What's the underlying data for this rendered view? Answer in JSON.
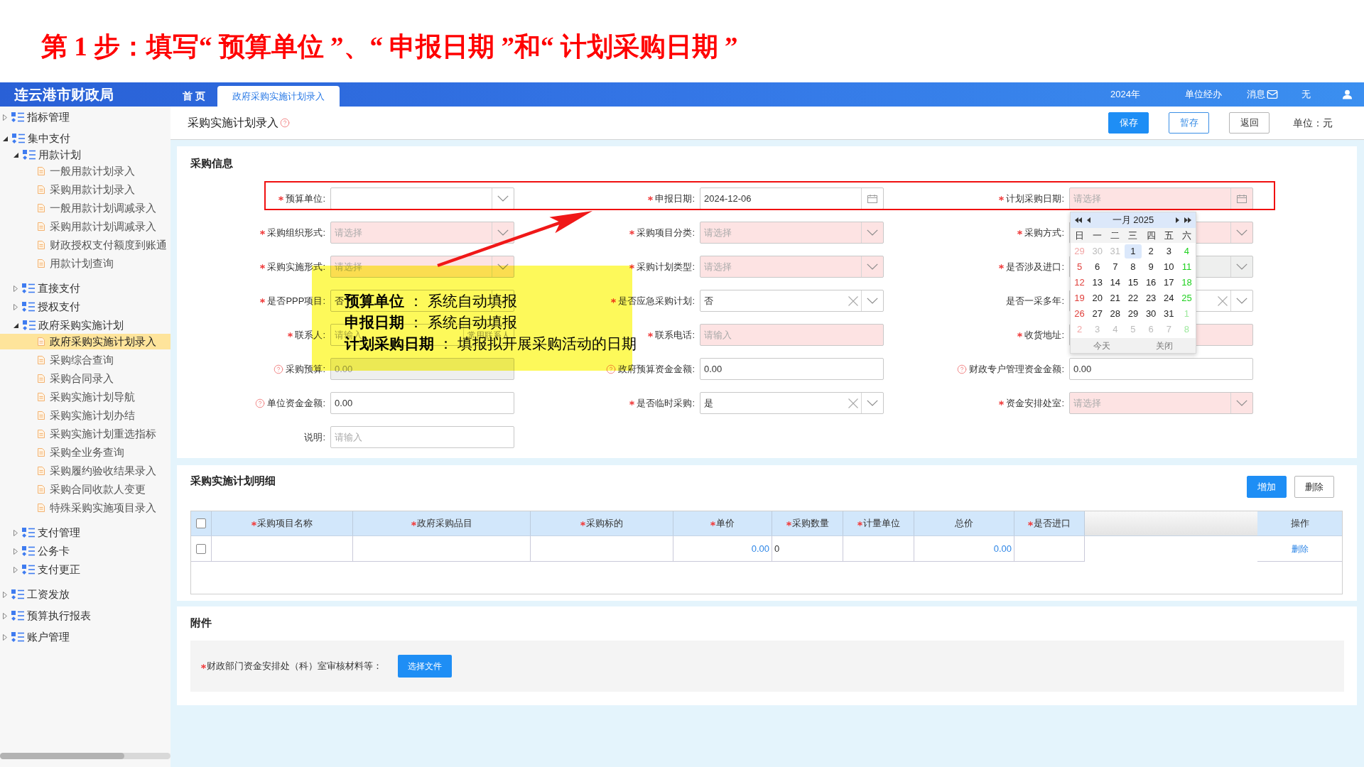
{
  "instruction": {
    "text": "第 1 步：填写“ 预算单位 ”、“ 申报日期 ”和“ 计划采购日期 ”"
  },
  "header": {
    "logo": "连云港市财政局",
    "tabs": [
      {
        "label": "首 页",
        "selected": false
      },
      {
        "label": "政府采购实施计划录入",
        "selected": true
      }
    ],
    "year": "2024年",
    "role": "单位经办",
    "messages": "消息",
    "user_name": "无"
  },
  "sidebar": {
    "items": [
      {
        "label": "指标管理",
        "kind": "folder",
        "expanded": false,
        "selected": false
      },
      {
        "label": "集中支付",
        "kind": "folder",
        "expanded": true,
        "selected": false,
        "children": [
          {
            "label": "用款计划",
            "kind": "folder",
            "expanded": true,
            "selected": false,
            "children": [
              {
                "label": "一般用款计划录入",
                "kind": "page",
                "selected": false
              },
              {
                "label": "采购用款计划录入",
                "kind": "page",
                "selected": false
              },
              {
                "label": "一般用款计划调减录入",
                "kind": "page",
                "selected": false
              },
              {
                "label": "采购用款计划调减录入",
                "kind": "page",
                "selected": false
              },
              {
                "label": "财政授权支付额度到账通",
                "kind": "page",
                "selected": false
              },
              {
                "label": "用款计划查询",
                "kind": "page",
                "selected": false
              }
            ]
          },
          {
            "label": "直接支付",
            "kind": "folder",
            "expanded": false,
            "selected": false
          },
          {
            "label": "授权支付",
            "kind": "folder",
            "expanded": false,
            "selected": false
          },
          {
            "label": "政府采购实施计划",
            "kind": "folder",
            "expanded": true,
            "selected": false,
            "children": [
              {
                "label": "政府采购实施计划录入",
                "kind": "page",
                "selected": true
              },
              {
                "label": "采购综合查询",
                "kind": "page",
                "selected": false
              },
              {
                "label": "采购合同录入",
                "kind": "page",
                "selected": false
              },
              {
                "label": "采购实施计划导航",
                "kind": "page",
                "selected": false
              },
              {
                "label": "采购实施计划办结",
                "kind": "page",
                "selected": false
              },
              {
                "label": "采购实施计划重选指标",
                "kind": "page",
                "selected": false
              },
              {
                "label": "采购全业务查询",
                "kind": "page",
                "selected": false
              },
              {
                "label": "采购履约验收结果录入",
                "kind": "page",
                "selected": false
              },
              {
                "label": "采购合同收款人变更",
                "kind": "page",
                "selected": false
              },
              {
                "label": "特殊采购实施项目录入",
                "kind": "page",
                "selected": false
              }
            ]
          },
          {
            "label": "支付管理",
            "kind": "folder",
            "expanded": false,
            "selected": false
          },
          {
            "label": "公务卡",
            "kind": "folder",
            "expanded": false,
            "selected": false
          },
          {
            "label": "支付更正",
            "kind": "folder",
            "expanded": false,
            "selected": false
          }
        ]
      },
      {
        "label": "工资发放",
        "kind": "folder",
        "expanded": false,
        "selected": false
      },
      {
        "label": "预算执行报表",
        "kind": "folder",
        "expanded": false,
        "selected": false
      },
      {
        "label": "账户管理",
        "kind": "folder",
        "expanded": false,
        "selected": false
      }
    ]
  },
  "page": {
    "title": "采购实施计划录入",
    "buttons": [
      {
        "label": "保存",
        "kind": "primary"
      },
      {
        "label": "暂存",
        "kind": "outline"
      },
      {
        "label": "返回",
        "kind": "plain"
      }
    ],
    "unit": "单位：元"
  },
  "purchase_info": {
    "title": "采购信息",
    "fields": [
      {
        "label": "预算单位:",
        "kind": "select",
        "required": true,
        "help": false,
        "invalid": false,
        "disabled": false,
        "clearable": false
      },
      {
        "label": "申报日期:",
        "kind": "date",
        "value": "2024-12-06",
        "required": true,
        "help": false,
        "invalid": false,
        "disabled": false,
        "clearable": false
      },
      {
        "label": "计划采购日期:",
        "kind": "date",
        "placeholder": "请选择",
        "required": true,
        "help": false,
        "invalid": true,
        "disabled": false,
        "clearable": false
      },
      {
        "label": "采购组织形式:",
        "kind": "select",
        "placeholder": "请选择",
        "required": true,
        "help": false,
        "invalid": true,
        "disabled": false,
        "clearable": false
      },
      {
        "label": "采购项目分类:",
        "kind": "select",
        "placeholder": "请选择",
        "required": true,
        "help": false,
        "invalid": true,
        "disabled": false,
        "clearable": false
      },
      {
        "label": "采购方式:",
        "kind": "select",
        "required": true,
        "help": false,
        "invalid": true,
        "disabled": false,
        "clearable": false
      },
      {
        "label": "采购实施形式:",
        "kind": "select",
        "placeholder": "请选择",
        "required": true,
        "help": false,
        "invalid": true,
        "disabled": false,
        "clearable": false
      },
      {
        "label": "采购计划类型:",
        "kind": "select",
        "placeholder": "请选择",
        "required": true,
        "help": false,
        "invalid": true,
        "disabled": false,
        "clearable": false
      },
      {
        "label": "是否涉及进口:",
        "kind": "select",
        "required": true,
        "help": false,
        "invalid": false,
        "disabled": true,
        "clearable": false
      },
      {
        "label": "是否PPP项目:",
        "kind": "select",
        "value": "否",
        "required": true,
        "help": false,
        "invalid": false,
        "disabled": false,
        "clearable": false
      },
      {
        "label": "是否应急采购计划:",
        "kind": "select",
        "value": "否",
        "required": true,
        "help": false,
        "invalid": false,
        "disabled": false,
        "clearable": true
      },
      {
        "label": "是否一采多年:",
        "kind": "select",
        "required": false,
        "help": false,
        "invalid": false,
        "disabled": false,
        "clearable": true
      },
      {
        "label": "联系人:",
        "kind": "text",
        "placeholder": "请输入",
        "action": "常用联系人",
        "required": true,
        "help": false,
        "invalid": false,
        "disabled": false,
        "clearable": false
      },
      {
        "label": "联系电话:",
        "kind": "text",
        "placeholder": "请输入",
        "required": true,
        "help": false,
        "invalid": true,
        "disabled": false,
        "clearable": false
      },
      {
        "label": "收货地址:",
        "kind": "text",
        "required": true,
        "help": false,
        "invalid": true,
        "disabled": false,
        "clearable": false
      },
      {
        "label": "采购预算:",
        "kind": "text",
        "value": "0.00",
        "required": false,
        "help": true,
        "invalid": false,
        "disabled": true,
        "clearable": false
      },
      {
        "label": "政府预算资金金额:",
        "kind": "text",
        "value": "0.00",
        "required": false,
        "help": true,
        "invalid": false,
        "disabled": false,
        "clearable": false
      },
      {
        "label": "财政专户管理资金金额:",
        "kind": "text",
        "value": "0.00",
        "required": false,
        "help": true,
        "invalid": false,
        "disabled": false,
        "clearable": false
      },
      {
        "label": "单位资金金额:",
        "kind": "text",
        "value": "0.00",
        "required": false,
        "help": true,
        "invalid": false,
        "disabled": false,
        "clearable": false
      },
      {
        "label": "是否临时采购:",
        "kind": "select",
        "value": "是",
        "required": true,
        "help": false,
        "invalid": false,
        "disabled": false,
        "clearable": true
      },
      {
        "label": "资金安排处室:",
        "kind": "select",
        "placeholder": "请选择",
        "required": true,
        "help": false,
        "invalid": true,
        "disabled": false,
        "clearable": false
      },
      {
        "label": "说明:",
        "kind": "text",
        "placeholder": "请输入",
        "required": false,
        "help": false,
        "invalid": false,
        "disabled": false,
        "clearable": false
      }
    ],
    "calendar": {
      "title": "一月 2025",
      "weekdays": [
        "日",
        "一",
        "二",
        "三",
        "四",
        "五",
        "六"
      ],
      "days": [
        {
          "text": "29",
          "outside": true,
          "selected": false
        },
        {
          "text": "30",
          "outside": true,
          "selected": false
        },
        {
          "text": "31",
          "outside": true,
          "selected": false
        },
        {
          "text": "1",
          "outside": false,
          "selected": true
        },
        {
          "text": "2",
          "outside": false,
          "selected": false
        },
        {
          "text": "3",
          "outside": false,
          "selected": false
        },
        {
          "text": "4",
          "outside": false,
          "selected": false
        },
        {
          "text": "5",
          "outside": false,
          "selected": false
        },
        {
          "text": "6",
          "outside": false,
          "selected": false
        },
        {
          "text": "7",
          "outside": false,
          "selected": false
        },
        {
          "text": "8",
          "outside": false,
          "selected": false
        },
        {
          "text": "9",
          "outside": false,
          "selected": false
        },
        {
          "text": "10",
          "outside": false,
          "selected": false
        },
        {
          "text": "11",
          "outside": false,
          "selected": false
        },
        {
          "text": "12",
          "outside": false,
          "selected": false
        },
        {
          "text": "13",
          "outside": false,
          "selected": false
        },
        {
          "text": "14",
          "outside": false,
          "selected": false
        },
        {
          "text": "15",
          "outside": false,
          "selected": false
        },
        {
          "text": "16",
          "outside": false,
          "selected": false
        },
        {
          "text": "17",
          "outside": false,
          "selected": false
        },
        {
          "text": "18",
          "outside": false,
          "selected": false
        },
        {
          "text": "19",
          "outside": false,
          "selected": false
        },
        {
          "text": "20",
          "outside": false,
          "selected": false
        },
        {
          "text": "21",
          "outside": false,
          "selected": false
        },
        {
          "text": "22",
          "outside": false,
          "selected": false
        },
        {
          "text": "23",
          "outside": false,
          "selected": false
        },
        {
          "text": "24",
          "outside": false,
          "selected": false
        },
        {
          "text": "25",
          "outside": false,
          "selected": false
        },
        {
          "text": "26",
          "outside": false,
          "selected": false
        },
        {
          "text": "27",
          "outside": false,
          "selected": false
        },
        {
          "text": "28",
          "outside": false,
          "selected": false
        },
        {
          "text": "29",
          "outside": false,
          "selected": false
        },
        {
          "text": "30",
          "outside": false,
          "selected": false
        },
        {
          "text": "31",
          "outside": false,
          "selected": false
        },
        {
          "text": "1",
          "outside": true,
          "selected": false
        },
        {
          "text": "2",
          "outside": true,
          "selected": false
        },
        {
          "text": "3",
          "outside": true,
          "selected": false
        },
        {
          "text": "4",
          "outside": true,
          "selected": false
        },
        {
          "text": "5",
          "outside": true,
          "selected": false
        },
        {
          "text": "6",
          "outside": true,
          "selected": false
        },
        {
          "text": "7",
          "outside": true,
          "selected": false
        },
        {
          "text": "8",
          "outside": true,
          "selected": false
        }
      ],
      "footer": [
        "今天",
        "关闭"
      ]
    }
  },
  "annotation": {
    "lines": [
      "**预算单位** ： 系统自动填报",
      "**申报日期** ： 系统自动填报",
      "**计划采购日期** ： 填报拟开展采购活动的日期"
    ]
  },
  "details": {
    "title": "采购实施计划明细",
    "buttons": [
      {
        "label": "增加",
        "kind": "primary"
      },
      {
        "label": "删除",
        "kind": "plain"
      }
    ],
    "table": {
      "header_checkbox": {
        "checked": false
      },
      "columns": [
        {
          "label": "采购项目名称",
          "required": true
        },
        {
          "label": "政府采购品目",
          "required": true
        },
        {
          "label": "采购标的",
          "required": true
        },
        {
          "label": "单价",
          "required": true
        },
        {
          "label": "采购数量",
          "required": true
        },
        {
          "label": "计量单位",
          "required": true
        },
        {
          "label": "总价",
          "required": false
        },
        {
          "label": "是否进口",
          "required": true
        },
        {
          "label": "操作",
          "required": false
        }
      ],
      "rows": [
        {
          "checked": false,
          "unit_price": "0.00",
          "quantity": "0",
          "total": "0.00",
          "action": "删除"
        }
      ]
    }
  },
  "attachments": {
    "title": "附件",
    "items": [
      {
        "label": "财政部门资金安排处（科）室审核材料等：",
        "required": true,
        "button": "选择文件"
      }
    ]
  }
}
